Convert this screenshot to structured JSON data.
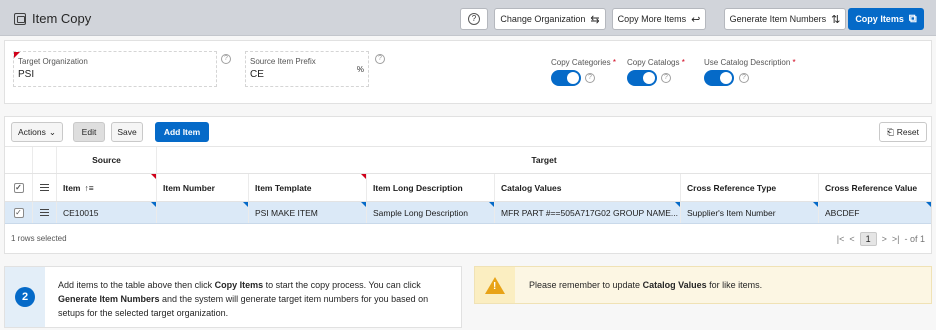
{
  "header": {
    "title": "Item Copy",
    "help_glyph": "?",
    "change_org_label": "Change Organization",
    "copy_more_label": "Copy More Items",
    "generate_label": "Generate Item Numbers",
    "copy_items_label": "Copy Items",
    "accent_color": "#056ac8"
  },
  "form": {
    "target_org_label": "Target Organization",
    "target_org_value": "PSI",
    "prefix_label": "Source Item Prefix",
    "prefix_value": "CE",
    "prefix_suffix": "%",
    "copy_categories_label": "Copy Categories",
    "copy_catalogs_label": "Copy Catalogs",
    "use_catalog_desc_label": "Use Catalog Description",
    "required_star": "*",
    "copy_categories_on": true,
    "copy_catalogs_on": true,
    "use_catalog_desc_on": true
  },
  "toolbar": {
    "actions_label": "Actions",
    "edit_label": "Edit",
    "save_label": "Save",
    "add_item_label": "Add Item",
    "reset_label": "Reset"
  },
  "grid": {
    "group_source": "Source",
    "group_target": "Target",
    "columns": {
      "item": "Item",
      "item_number": "Item Number",
      "item_template": "Item Template",
      "item_long_desc": "Item Long Description",
      "catalog_values": "Catalog Values",
      "cross_ref_type": "Cross Reference Type",
      "cross_ref_value": "Cross Reference Value"
    },
    "rows": [
      {
        "checked": "✓",
        "item": "CE10015",
        "item_number": "",
        "item_template": "PSI MAKE ITEM",
        "item_long_desc": "Sample Long Description",
        "catalog_values": "MFR PART #==505A717G02 GROUP NAME...",
        "cross_ref_type": "Supplier's Item Number",
        "cross_ref_value": "ABCDEF"
      }
    ],
    "header_check": "✓",
    "status": "1 rows selected",
    "pager": {
      "first": "|<",
      "prev": "<",
      "page": "1",
      "next": ">",
      "last": ">|",
      "of": "- of 1"
    }
  },
  "info": {
    "step": "2",
    "t1": "Add items to the table above then click ",
    "b1": "Copy Items",
    "t2": " to start the copy process. You can click ",
    "b2": "Generate Item Numbers",
    "t3": " and the system will generate target item numbers for you based on setups for the selected target organization."
  },
  "warning": {
    "glyph": "!",
    "t1": "Please remember to update ",
    "b1": "Catalog Values",
    "t2": " for like items."
  }
}
